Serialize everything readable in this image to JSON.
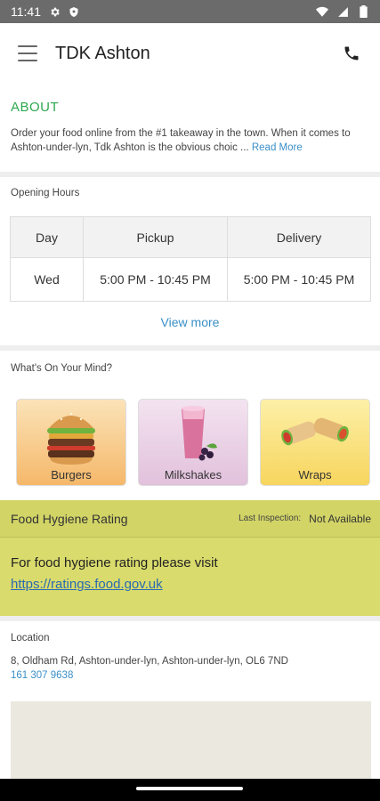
{
  "status_bar": {
    "time": "11:41",
    "left_icons": [
      "gear-icon",
      "shield-icon"
    ],
    "right_icons": [
      "wifi-icon",
      "signal-icon",
      "battery-icon"
    ]
  },
  "app_bar": {
    "title": "TDK Ashton",
    "left_icon": "menu-icon",
    "right_icon": "phone-icon"
  },
  "about": {
    "title": "ABOUT",
    "text": "Order your food online from the #1 takeaway in the town. When it comes to Ashton-under-lyn, Tdk Ashton is the obvious choic ...",
    "read_more": "Read More"
  },
  "opening_hours": {
    "label": "Opening Hours",
    "headers": [
      "Day",
      "Pickup",
      "Delivery"
    ],
    "rows": [
      {
        "day": "Wed",
        "pickup": "5:00 PM - 10:45 PM",
        "delivery": "5:00 PM - 10:45 PM"
      }
    ],
    "view_more": "View more"
  },
  "categories": {
    "label": "What's On Your Mind?",
    "items": [
      {
        "label": "Burgers",
        "icon": "burger-icon",
        "bg": "#f7c98a"
      },
      {
        "label": "Milkshakes",
        "icon": "milkshake-icon",
        "bg": "#e8c9e2"
      },
      {
        "label": "Wraps",
        "icon": "wrap-icon",
        "bg": "#fbe07a"
      }
    ]
  },
  "hygiene": {
    "title": "Food Hygiene Rating",
    "inspection_label": "Last Inspection:",
    "inspection_value": "Not Available",
    "text": "For food hygiene rating please visit",
    "link": "https://ratings.food.gov.uk"
  },
  "location": {
    "label": "Location",
    "address": "8, Oldham Rd, Ashton-under-lyn, Ashton-under-lyn, OL6 7ND",
    "phone": "161 307 9638"
  },
  "colors": {
    "accent_green": "#2fa84f",
    "link_blue": "#3a8fc7",
    "hygiene_bg": "#d9db6c"
  }
}
